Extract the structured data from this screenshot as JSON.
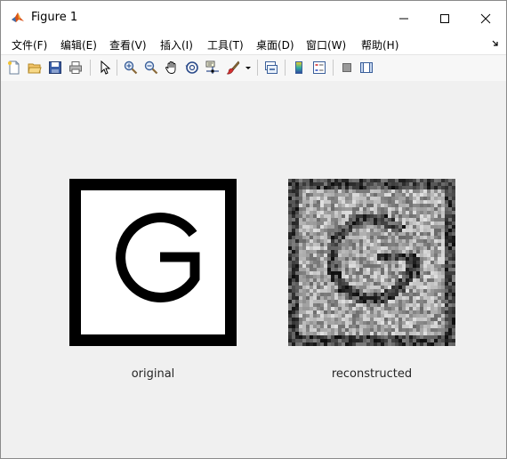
{
  "window": {
    "title": "Figure 1"
  },
  "menubar": {
    "items": [
      {
        "label": "文件(F)"
      },
      {
        "label": "编辑(E)"
      },
      {
        "label": "查看(V)"
      },
      {
        "label": "插入(I)"
      },
      {
        "label": "工具(T)"
      },
      {
        "label": "桌面(D)"
      },
      {
        "label": "窗口(W)"
      },
      {
        "label": "帮助(H)"
      }
    ]
  },
  "toolbar": {
    "buttons": [
      {
        "icon": "new-figure-icon"
      },
      {
        "icon": "open-file-icon"
      },
      {
        "icon": "save-icon"
      },
      {
        "icon": "print-icon"
      },
      {
        "icon": "edit-plot-icon"
      },
      {
        "icon": "zoom-in-icon"
      },
      {
        "icon": "zoom-out-icon"
      },
      {
        "icon": "pan-icon"
      },
      {
        "icon": "rotate-3d-icon"
      },
      {
        "icon": "data-cursor-icon"
      },
      {
        "icon": "brush-icon"
      },
      {
        "icon": "link-plot-icon"
      },
      {
        "icon": "colorbar-icon"
      },
      {
        "icon": "legend-icon"
      },
      {
        "icon": "hide-plot-tools-icon"
      },
      {
        "icon": "show-plot-tools-icon"
      }
    ]
  },
  "axes": [
    {
      "label": "original"
    },
    {
      "label": "reconstructed"
    }
  ],
  "colors": {
    "titlebar_bg": "#ffffff",
    "figure_bg": "#f0f0f0",
    "label_text": "#262626"
  }
}
